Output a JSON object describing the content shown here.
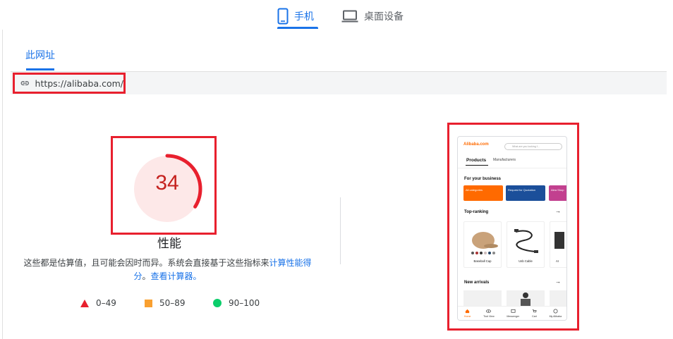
{
  "device_tabs": {
    "mobile": "手机",
    "desktop": "桌面设备"
  },
  "url_tabs": {
    "active": "此网址"
  },
  "url_bar": {
    "url": "https://alibaba.com/"
  },
  "performance": {
    "score": "34",
    "score_value": 34,
    "title": "性能",
    "desc_text": "这些都是估算值，且可能会因时而异。系统会直接基于这些指标来",
    "desc_link_1": "计算性能得分",
    "desc_mid": "。",
    "desc_link_2": "查看计算器。",
    "colors": {
      "poor": "#e8202e",
      "average": "#f9a030",
      "good": "#0cce6b"
    },
    "legend": [
      {
        "range": "0–49"
      },
      {
        "range": "50–89"
      },
      {
        "range": "90–100"
      }
    ]
  },
  "screenshot": {
    "logo": "Alibaba.com",
    "search_placeholder": "What are you looking f...",
    "tab_active": "Products",
    "tab_inactive": "Manufacturers",
    "section_business": "For your business",
    "cards": [
      {
        "label": "All categories"
      },
      {
        "label": "Request for Quotation"
      },
      {
        "label": "Alea Shop"
      }
    ],
    "section_ranking": "Top-ranking",
    "products": [
      {
        "name": "Baseball Cap"
      },
      {
        "name": "Usb Cable"
      },
      {
        "name": "Ar"
      }
    ],
    "section_arrivals": "New arrivals",
    "nav": [
      {
        "label": "Home"
      },
      {
        "label": "Tiu# View"
      },
      {
        "label": "Messenger"
      },
      {
        "label": "Cart"
      },
      {
        "label": "My Alibaba"
      }
    ]
  }
}
